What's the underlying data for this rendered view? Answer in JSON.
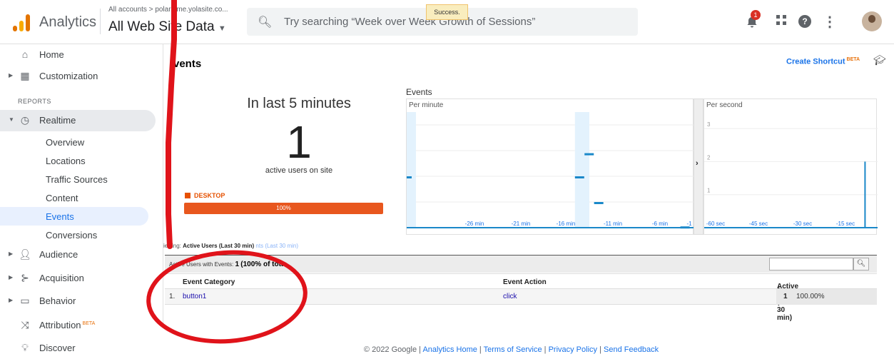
{
  "header": {
    "brand": "Analytics",
    "breadcrumb": "All accounts > polar.dme.yolasite.co...",
    "view": "All Web Site Data",
    "search_placeholder": "Try searching “Week over Week Growth of Sessions”",
    "toast": "Success.",
    "notification_count": "1"
  },
  "sidebar": {
    "home": "Home",
    "customization": "Customization",
    "reports_section": "REPORTS",
    "realtime": "Realtime",
    "realtime_items": [
      "Overview",
      "Locations",
      "Traffic Sources",
      "Content",
      "Events",
      "Conversions"
    ],
    "audience": "Audience",
    "acquisition": "Acquisition",
    "behavior": "Behavior",
    "attribution": "Attribution",
    "attribution_badge": "BETA",
    "discover": "Discover"
  },
  "main": {
    "title": "vents",
    "create_shortcut": "Create Shortcut",
    "create_shortcut_badge": "BETA",
    "last_label": "In last 5 minutes",
    "active_count": "1",
    "active_label": "active users on site",
    "device_label": "DESKTOP",
    "device_percent": "100%",
    "events_label": "Events",
    "per_minute": "Per minute",
    "per_second": "Per second",
    "viewing_prefix": "iewing:",
    "viewing_active": "Active Users (Last 30 min)",
    "viewing_other": "nts (Last 30 min)",
    "summary_prefix": "Active Users with Events:",
    "summary_count": "1",
    "summary_pct": "(100% of tota",
    "columns": [
      "Event Category",
      "Event Action",
      "Active Users (Last 30 min)"
    ],
    "rows": [
      {
        "index": "1.",
        "category": "button1",
        "action": "click",
        "users": "1",
        "pct": "100.00%"
      }
    ]
  },
  "chart_data": [
    {
      "type": "bar",
      "title": "Per minute",
      "ylim": [
        0,
        90
      ],
      "yticks": [
        "20",
        "40",
        "60",
        "80"
      ],
      "xtick_labels": [
        "-26 min",
        "-21 min",
        "-16 min",
        "-11 min",
        "-6 min",
        "min",
        "-1"
      ],
      "bars": [
        {
          "x": -30,
          "value": 40
        },
        {
          "x": -12,
          "value": 40
        },
        {
          "x": -11,
          "value": 58
        },
        {
          "x": -10,
          "value": 20
        },
        {
          "x": -1,
          "value": 1
        }
      ],
      "x_range": [
        -30,
        0
      ]
    },
    {
      "type": "bar",
      "title": "Per second",
      "ylim": [
        0,
        3.5
      ],
      "yticks": [
        "1",
        "2",
        "3"
      ],
      "xtick_labels": [
        "-60 sec",
        "-45 sec",
        "-30 sec",
        "-15 sec"
      ],
      "bars": [
        {
          "x": -3,
          "value": 2
        }
      ],
      "x_range": [
        -60,
        0
      ]
    }
  ],
  "footer": {
    "copyright": "© 2022 Google |",
    "links": [
      "Analytics Home",
      "Terms of Service",
      "Privacy Policy",
      "Send Feedback"
    ]
  },
  "colors": {
    "accent": "#1a73e8",
    "device": "#e8571e",
    "bars": "#1a88c9",
    "annotation": "#e0131a"
  }
}
